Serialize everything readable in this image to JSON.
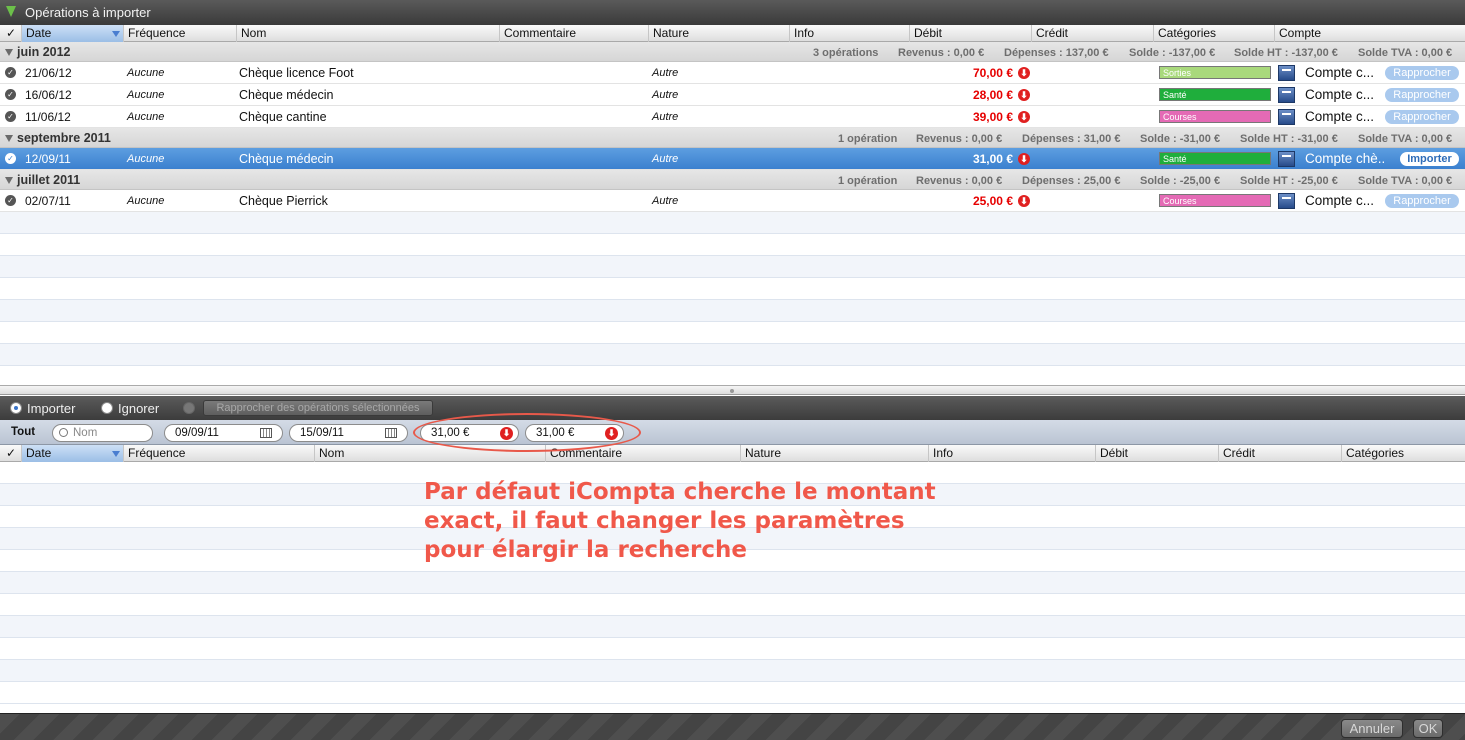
{
  "window": {
    "title": "Opérations à importer"
  },
  "columns": [
    {
      "label": "✓"
    },
    {
      "label": "Date"
    },
    {
      "label": "Fréquence"
    },
    {
      "label": "Nom"
    },
    {
      "label": "Commentaire"
    },
    {
      "label": "Nature"
    },
    {
      "label": "Info"
    },
    {
      "label": "Débit"
    },
    {
      "label": "Crédit"
    },
    {
      "label": "Catégories"
    },
    {
      "label": "Compte"
    }
  ],
  "groups": [
    {
      "name": "juin 2012",
      "count": "3 opérations",
      "revenus": "Revenus : 0,00 €",
      "depenses": "Dépenses : 137,00 €",
      "solde": "Solde : -137,00 €",
      "solde_ht": "Solde HT : -137,00 €",
      "solde_tva": "Solde TVA : 0,00 €",
      "rows": [
        {
          "date": "21/06/12",
          "frequence": "Aucune",
          "nom": "Chèque licence Foot",
          "nature": "Autre",
          "debit": "70,00 €",
          "categorie": "Sorties",
          "cat_color": "#a9d97c",
          "compte": "Compte c...",
          "action": "Rapprocher"
        },
        {
          "date": "16/06/12",
          "frequence": "Aucune",
          "nom": "Chèque médecin",
          "nature": "Autre",
          "debit": "28,00 €",
          "categorie": "Santé",
          "cat_color": "#1fae3c",
          "compte": "Compte c...",
          "action": "Rapprocher"
        },
        {
          "date": "11/06/12",
          "frequence": "Aucune",
          "nom": "Chèque cantine",
          "nature": "Autre",
          "debit": "39,00 €",
          "categorie": "Courses",
          "cat_color": "#e46ab5",
          "compte": "Compte c...",
          "action": "Rapprocher"
        }
      ]
    },
    {
      "name": "septembre 2011",
      "count": "1 opération",
      "revenus": "Revenus : 0,00 €",
      "depenses": "Dépenses : 31,00 €",
      "solde": "Solde : -31,00 €",
      "solde_ht": "Solde HT : -31,00 €",
      "solde_tva": "Solde TVA : 0,00 €",
      "rows": [
        {
          "date": "12/09/11",
          "frequence": "Aucune",
          "nom": "Chèque médecin",
          "nature": "Autre",
          "debit": "31,00 €",
          "categorie": "Santé",
          "cat_color": "#1fae3c",
          "compte": "Compte chè...",
          "action": "Importer",
          "selected": true
        }
      ]
    },
    {
      "name": "juillet 2011",
      "count": "1 opération",
      "revenus": "Revenus : 0,00 €",
      "depenses": "Dépenses : 25,00 €",
      "solde": "Solde : -25,00 €",
      "solde_ht": "Solde HT : -25,00 €",
      "solde_tva": "Solde TVA : 0,00 €",
      "rows": [
        {
          "date": "02/07/11",
          "frequence": "Aucune",
          "nom": "Chèque Pierrick",
          "nature": "Autre",
          "debit": "25,00 €",
          "categorie": "Courses",
          "cat_color": "#e46ab5",
          "compte": "Compte c...",
          "action": "Rapprocher"
        }
      ]
    }
  ],
  "bottom": {
    "radio_importer": "Importer",
    "radio_ignorer": "Ignorer",
    "rapprocher_btn": "Rapprocher des opérations sélectionnées",
    "filter_all": "Tout",
    "search_placeholder": "Nom",
    "date_from": "09/09/11",
    "date_to": "15/09/11",
    "amount_min": "31,00 €",
    "amount_max": "31,00 €",
    "columns": [
      "✓",
      "Date",
      "Fréquence",
      "Nom",
      "Commentaire",
      "Nature",
      "Info",
      "Débit",
      "Crédit",
      "Catégories"
    ]
  },
  "annotation": [
    "Par défaut iCompta cherche le montant",
    "exact, il faut changer les paramètres",
    "pour élargir la recherche"
  ],
  "footer": {
    "cancel": "Annuler",
    "ok": "OK"
  },
  "colors": {
    "accent": "#3b80cf",
    "debit": "#e60000",
    "annotation": "#f0584a"
  }
}
